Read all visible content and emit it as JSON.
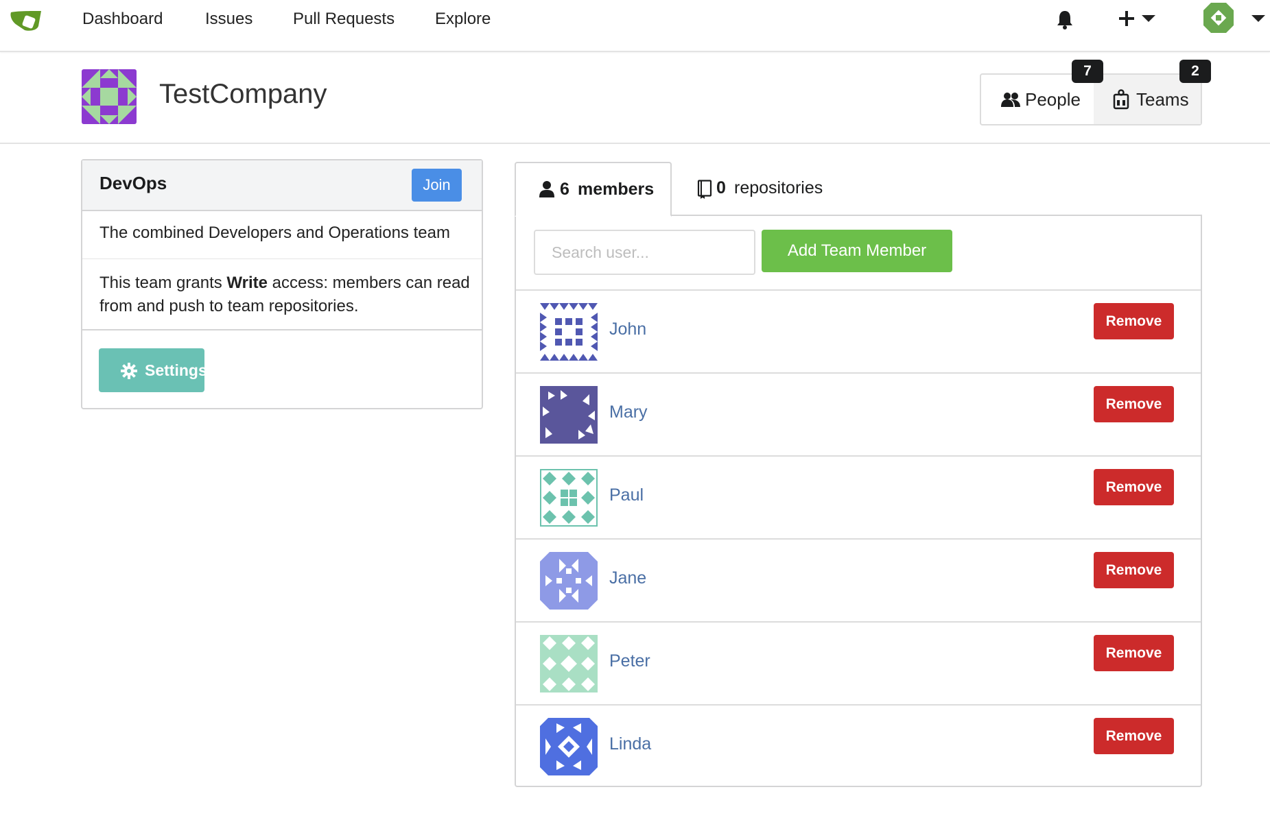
{
  "nav": {
    "links": [
      "Dashboard",
      "Issues",
      "Pull Requests",
      "Explore"
    ],
    "brand_color": "#609926"
  },
  "org": {
    "name": "TestCompany",
    "people_label": "People",
    "people_count": "7",
    "teams_label": "Teams",
    "teams_count": "2"
  },
  "team": {
    "name": "DevOps",
    "join_label": "Join",
    "description": "The combined Developers and Operations team",
    "access_prefix": "This team grants ",
    "access_level": "Write",
    "access_suffix": " access: members can read from and push to team repositories.",
    "settings_label": "Settings"
  },
  "tabs": {
    "members_count": "6",
    "members_label": "members",
    "repos_count": "0",
    "repos_label": "repositories"
  },
  "search": {
    "placeholder": "Search user...",
    "value": ""
  },
  "add_member_label": "Add Team Member",
  "remove_label": "Remove",
  "members": [
    {
      "name": "John",
      "color": "#5058b2"
    },
    {
      "name": "Mary",
      "color": "#5a569b"
    },
    {
      "name": "Paul",
      "color": "#6cc2ad"
    },
    {
      "name": "Jane",
      "color": "#8e9ae6"
    },
    {
      "name": "Peter",
      "color": "#a9dfc4"
    },
    {
      "name": "Linda",
      "color": "#4f6fe0"
    }
  ],
  "colors": {
    "join": "#4a8ee6",
    "settings": "#6ac1b4",
    "add": "#6cbf4a",
    "remove": "#cc2b2b",
    "org_avatar": "#8c3ad0",
    "org_avatar_accent": "#a6d9a0"
  }
}
